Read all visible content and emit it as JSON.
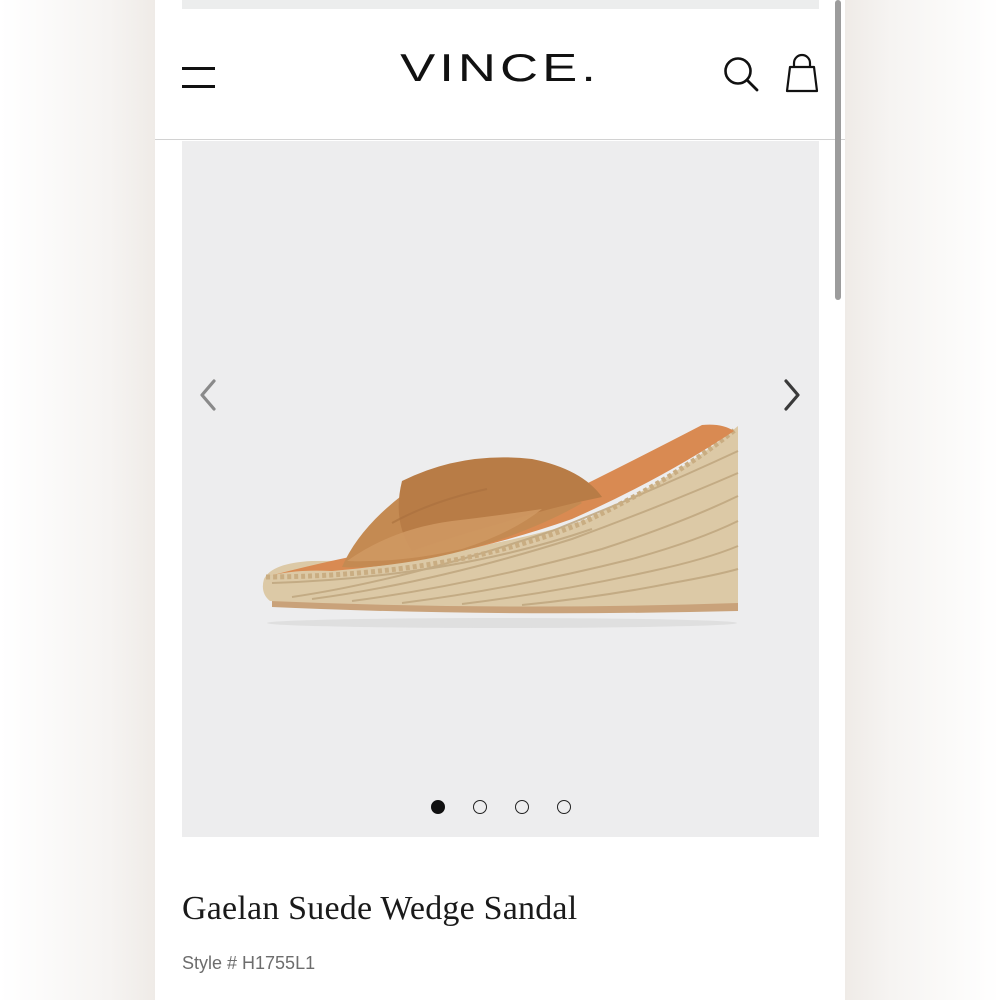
{
  "header": {
    "brand": "VINCE.",
    "menu_icon": "hamburger-menu-icon",
    "search_icon": "search-icon",
    "bag_icon": "shopping-bag-icon"
  },
  "gallery": {
    "prev_icon": "chevron-left-icon",
    "next_icon": "chevron-right-icon",
    "image_alt": "Gaelan Suede Wedge Sandal",
    "slide_count": 4,
    "active_slide": 1
  },
  "product": {
    "title": "Gaelan Suede Wedge Sandal",
    "style": "Style # H1755L1"
  },
  "colors": {
    "suede": "#c48a52",
    "jute": "#dcc9a6",
    "gallery_bg": "#ededee"
  }
}
